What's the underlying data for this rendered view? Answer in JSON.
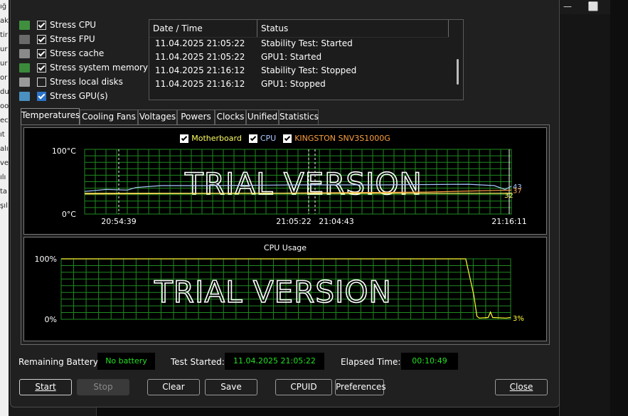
{
  "background": {
    "left_fragments": [
      "ığ",
      "ak",
      "tir",
      "ur",
      "ur",
      "or",
      "du",
      "oo",
      "",
      "ec",
      "ıt",
      "alı",
      "ve",
      "ılı",
      "ta",
      "şıl"
    ],
    "titlebar_buttons": [
      "—",
      "⬜"
    ]
  },
  "stress_options": [
    {
      "label": "Stress CPU",
      "checked": true,
      "icon": "cpu-icon",
      "icon_color": "#3f8f3f"
    },
    {
      "label": "Stress FPU",
      "checked": true,
      "icon": "fpu-icon",
      "icon_color": "#6a6a6a"
    },
    {
      "label": "Stress cache",
      "checked": true,
      "icon": "cache-icon",
      "icon_color": "#8a8a8a"
    },
    {
      "label": "Stress system memory",
      "checked": true,
      "icon": "memory-icon",
      "icon_color": "#3b8a3b"
    },
    {
      "label": "Stress local disks",
      "checked": false,
      "icon": "disk-icon",
      "icon_color": "#9a9a9a"
    },
    {
      "label": "Stress GPU(s)",
      "checked": true,
      "icon": "gpu-icon",
      "icon_color": "#4a90c0"
    }
  ],
  "log": {
    "columns": [
      "Date / Time",
      "Status"
    ],
    "rows": [
      {
        "time": "11.04.2025 21:05:22",
        "status": "Stability Test: Started"
      },
      {
        "time": "11.04.2025 21:05:22",
        "status": "GPU1: Started"
      },
      {
        "time": "11.04.2025 21:16:12",
        "status": "Stability Test: Stopped"
      },
      {
        "time": "11.04.2025 21:16:12",
        "status": "GPU1: Stopped"
      }
    ]
  },
  "tabs": [
    "Temperatures",
    "Cooling Fans",
    "Voltages",
    "Powers",
    "Clocks",
    "Unified",
    "Statistics"
  ],
  "active_tab": "Temperatures",
  "temp_chart": {
    "legend": [
      {
        "label": "Motherboard",
        "checked": true,
        "color": "#ffff66"
      },
      {
        "label": "CPU",
        "checked": true,
        "color": "#a8c8ff"
      },
      {
        "label": "KINGSTON SNV3S1000G",
        "checked": true,
        "color": "#ffa040"
      }
    ],
    "y_max_label": "100°C",
    "y_min_label": "0°C",
    "x_labels": [
      "20:54:39",
      "21:05:22",
      "21:04:43",
      "21:16:11"
    ],
    "watermark": "TRIAL VERSION",
    "end_values": [
      "43",
      "37",
      "32"
    ],
    "end_colors": [
      "#a8c8ff",
      "#ffa040",
      "#ffff66"
    ]
  },
  "cpu_chart": {
    "title": "CPU Usage",
    "y_max_label": "100%",
    "y_min_label": "0%",
    "watermark": "TRIAL VERSION",
    "end_value": "3%",
    "end_color": "#ffff33"
  },
  "chart_data": [
    {
      "type": "line",
      "title": "",
      "ylim": [
        0,
        100
      ],
      "ylabel": "°C",
      "x_tick_labels": [
        "20:54:39",
        "21:05:22",
        "21:04:43",
        "21:16:11"
      ],
      "series": [
        {
          "name": "CPU",
          "color": "#a8c8ff",
          "x": [
            0,
            0.02,
            0.05,
            0.1,
            0.12,
            0.18,
            0.3,
            0.5,
            0.7,
            0.9,
            0.96,
            0.985,
            1.0
          ],
          "values": [
            35,
            36,
            38,
            37,
            41,
            44,
            44,
            45,
            45,
            46,
            44,
            38,
            43
          ]
        },
        {
          "name": "KINGSTON SNV3S1000G",
          "color": "#ffa040",
          "x": [
            0,
            0.2,
            0.4,
            0.6,
            0.8,
            1.0
          ],
          "values": [
            31,
            31.5,
            32,
            33,
            34,
            37
          ]
        },
        {
          "name": "Motherboard",
          "color": "#ffff66",
          "x": [
            0,
            0.2,
            0.4,
            0.6,
            0.8,
            1.0
          ],
          "values": [
            32,
            32,
            32,
            32,
            32,
            32
          ]
        }
      ]
    },
    {
      "type": "line",
      "title": "CPU Usage",
      "ylim": [
        0,
        100
      ],
      "ylabel": "%",
      "series": [
        {
          "name": "",
          "color": "#ffff33",
          "x": [
            0,
            0.85,
            0.9,
            0.9,
            0.9,
            0.935,
            0.94,
            0.945,
            0.95,
            0.96,
            1.0
          ],
          "values": [
            100,
            100,
            100,
            100,
            100,
            100,
            100,
            100,
            100,
            100,
            100
          ]
        }
      ],
      "tail": {
        "x": [
          0.9,
          0.918,
          0.925,
          0.93,
          0.95,
          0.955,
          0.96,
          0.99,
          1.0
        ],
        "values": [
          100,
          40,
          5,
          2,
          3,
          12,
          3,
          2,
          3
        ]
      }
    }
  ],
  "status_bar": {
    "battery_label": "Remaining Battery:",
    "battery_value": "No battery",
    "started_label": "Test Started:",
    "started_value": "11.04.2025 21:05:22",
    "elapsed_label": "Elapsed Time:",
    "elapsed_value": "00:10:49"
  },
  "buttons": {
    "start": "Start",
    "stop": "Stop",
    "clear": "Clear",
    "save": "Save",
    "cpuid": "CPUID",
    "preferences": "Preferences",
    "close": "Close"
  },
  "colors": {
    "grid": "#1f8a1f",
    "chart_bg": "#000000",
    "status_green": "#22e022"
  }
}
